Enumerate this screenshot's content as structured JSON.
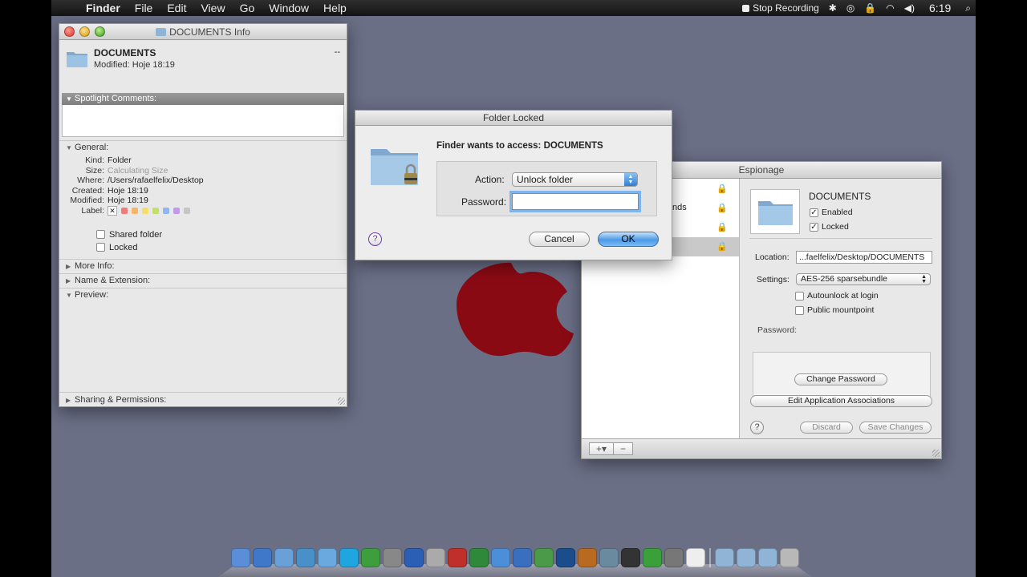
{
  "menubar": {
    "items": [
      "Finder",
      "File",
      "Edit",
      "View",
      "Go",
      "Window",
      "Help"
    ],
    "stop_recording": "Stop Recording",
    "clock": "6:19"
  },
  "info_window": {
    "title": "DOCUMENTS Info",
    "name": "DOCUMENTS",
    "modified_header": "Modified: Hoje 18:19",
    "size_header": "--",
    "spotlight_label": "Spotlight Comments:",
    "general_label": "General:",
    "general": [
      {
        "key": "Kind:",
        "value": "Folder"
      },
      {
        "key": "Size:",
        "value": "Calculating Size"
      },
      {
        "key": "Where:",
        "value": "/Users/rafaelfelix/Desktop"
      },
      {
        "key": "Created:",
        "value": "Hoje 18:19"
      },
      {
        "key": "Modified:",
        "value": "Hoje 18:19"
      }
    ],
    "label_key": "Label:",
    "label_colors": [
      "#f27a7a",
      "#f5b66a",
      "#f2e06a",
      "#bfe06a",
      "#8fb6ee",
      "#c49ae8",
      "#c6c6c6"
    ],
    "shared_folder": "Shared folder",
    "locked": "Locked",
    "more_info": "More Info:",
    "name_extension": "Name & Extension:",
    "preview": "Preview:",
    "sharing": "Sharing & Permissions:"
  },
  "dialog": {
    "title": "Folder Locked",
    "prompt": "Finder wants to access: DOCUMENTS",
    "action_label": "Action:",
    "action_value": "Unlock folder",
    "password_label": "Password:",
    "password_value": "",
    "cancel": "Cancel",
    "ok": "OK",
    "help": "?"
  },
  "espionage": {
    "title": "Espionage",
    "partial_list_text": "nds",
    "name": "DOCUMENTS",
    "enabled": "Enabled",
    "locked": "Locked",
    "location_label": "Location:",
    "location_value": "...faelfelix/Desktop/DOCUMENTS",
    "settings_label": "Settings:",
    "settings_value": "AES-256 sparsebundle",
    "autounlock": "Autounlock at login",
    "public_mountpoint": "Public mountpoint",
    "password_label": "Password:",
    "change_password": "Change Password",
    "edit_associations": "Edit Application Associations",
    "discard": "Discard",
    "save_changes": "Save Changes",
    "help": "?",
    "add": "+▾",
    "remove": "−"
  },
  "dock": {
    "icons": [
      "finder-icon",
      "appstore-icon",
      "preview-icon",
      "safari-icon",
      "contacts-icon",
      "skype-icon",
      "utorrent-icon",
      "trash-app-icon",
      "word-icon",
      "lock-icon",
      "acrobat-icon",
      "excel-icon",
      "itunes-icon",
      "quicktime-icon",
      "timemachine-icon",
      "photoshop-icon",
      "bridge-icon",
      "iphoto-icon",
      "dvd-icon",
      "green-icon",
      "espionage-icon",
      "textedit-icon",
      "folder-icon",
      "folder-icon",
      "folder-icon",
      "trash-icon"
    ],
    "colors": [
      "#5a8ed8",
      "#3f78c8",
      "#6aa0d8",
      "#4a90c8",
      "#6aa8e0",
      "#1fa6e0",
      "#3e9e3e",
      "#888",
      "#2b5fb5",
      "#aaa",
      "#c0302a",
      "#2e8a3a",
      "#4b8fd8",
      "#3a6fc0",
      "#4a9a4a",
      "#1b4c8c",
      "#b86a20",
      "#6a8aa0",
      "#333",
      "#3aa03a",
      "#777",
      "#eee",
      "#8fb4d6",
      "#8fb4d6",
      "#8fb4d6",
      "#b8b8b8"
    ]
  }
}
